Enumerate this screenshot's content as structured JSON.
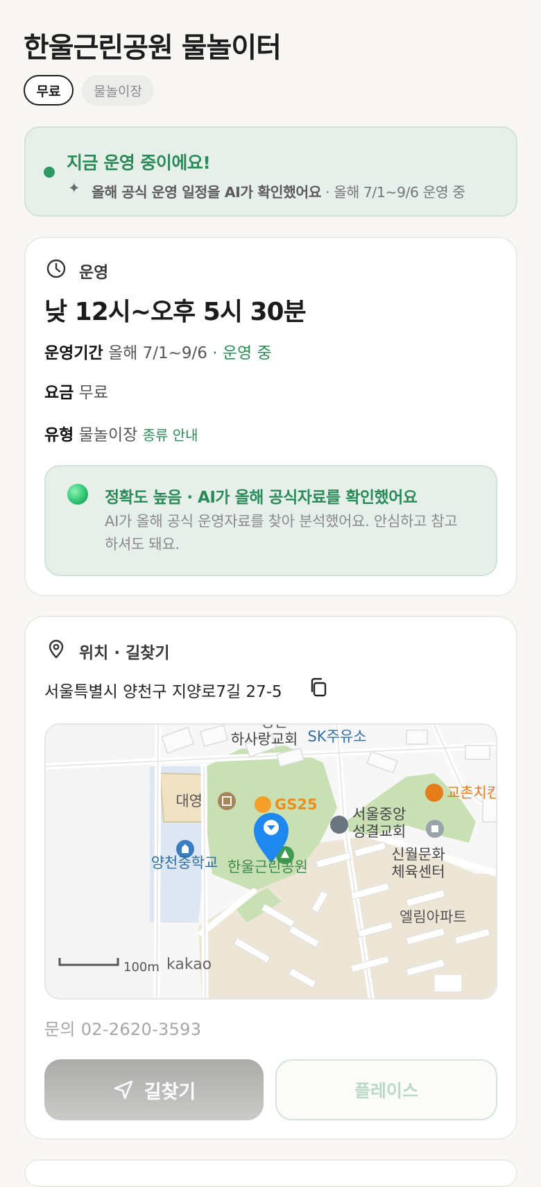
{
  "header": {
    "title": "한울근린공원 물놀이터",
    "chips": [
      "무료",
      "물놀이장"
    ]
  },
  "status": {
    "title": "지금 운영 중이에요!",
    "sub_bold": "올해 공식 운영 일정을 AI가 확인했어요",
    "sub_rest": " · 올해 7/1~9/6 운영 중"
  },
  "operation": {
    "section_title": "운영",
    "hours": "낮 12시~오후 5시 30분",
    "period_label": "운영기간",
    "period_value": "올해 7/1~9/6",
    "period_status": "· 운영 중",
    "fee_label": "요금",
    "fee_value": "무료",
    "type_label": "유형",
    "type_value": "물놀이장",
    "type_link": "종류 안내",
    "ai_title": "정확도 높음 · AI가 올해 공식자료를 확인했어요",
    "ai_body": "AI가 올해 공식 운영자료를 찾아 분석했어요. 안심하고 참고하셔도 돼요."
  },
  "location": {
    "section_title": "위치 · 길찾기",
    "address": "서울특별시 양천구 지양로7길 27-5",
    "map": {
      "labels": {
        "church1": "하사랑교회",
        "church1_top": "봉은",
        "gas": "SK주유소",
        "daeyoung": "대영",
        "gs25": "GS25",
        "church2_a": "서울중앙",
        "church2_b": "성결교회",
        "kyochon": "교촌치킨",
        "school": "양천중학교",
        "park": "한울근린공원",
        "culture_a": "신월문화",
        "culture_b": "체육센터",
        "apt": "엘림아파트",
        "scale": "100m",
        "brand": "kakao"
      }
    },
    "contact": "문의 02-2620-3593",
    "route_button": "길찾기",
    "place_button": "플레이스"
  },
  "colors": {
    "accent_green": "#2a8a58",
    "status_bg": "#e6efea",
    "map_pin": "#1e88f0"
  }
}
